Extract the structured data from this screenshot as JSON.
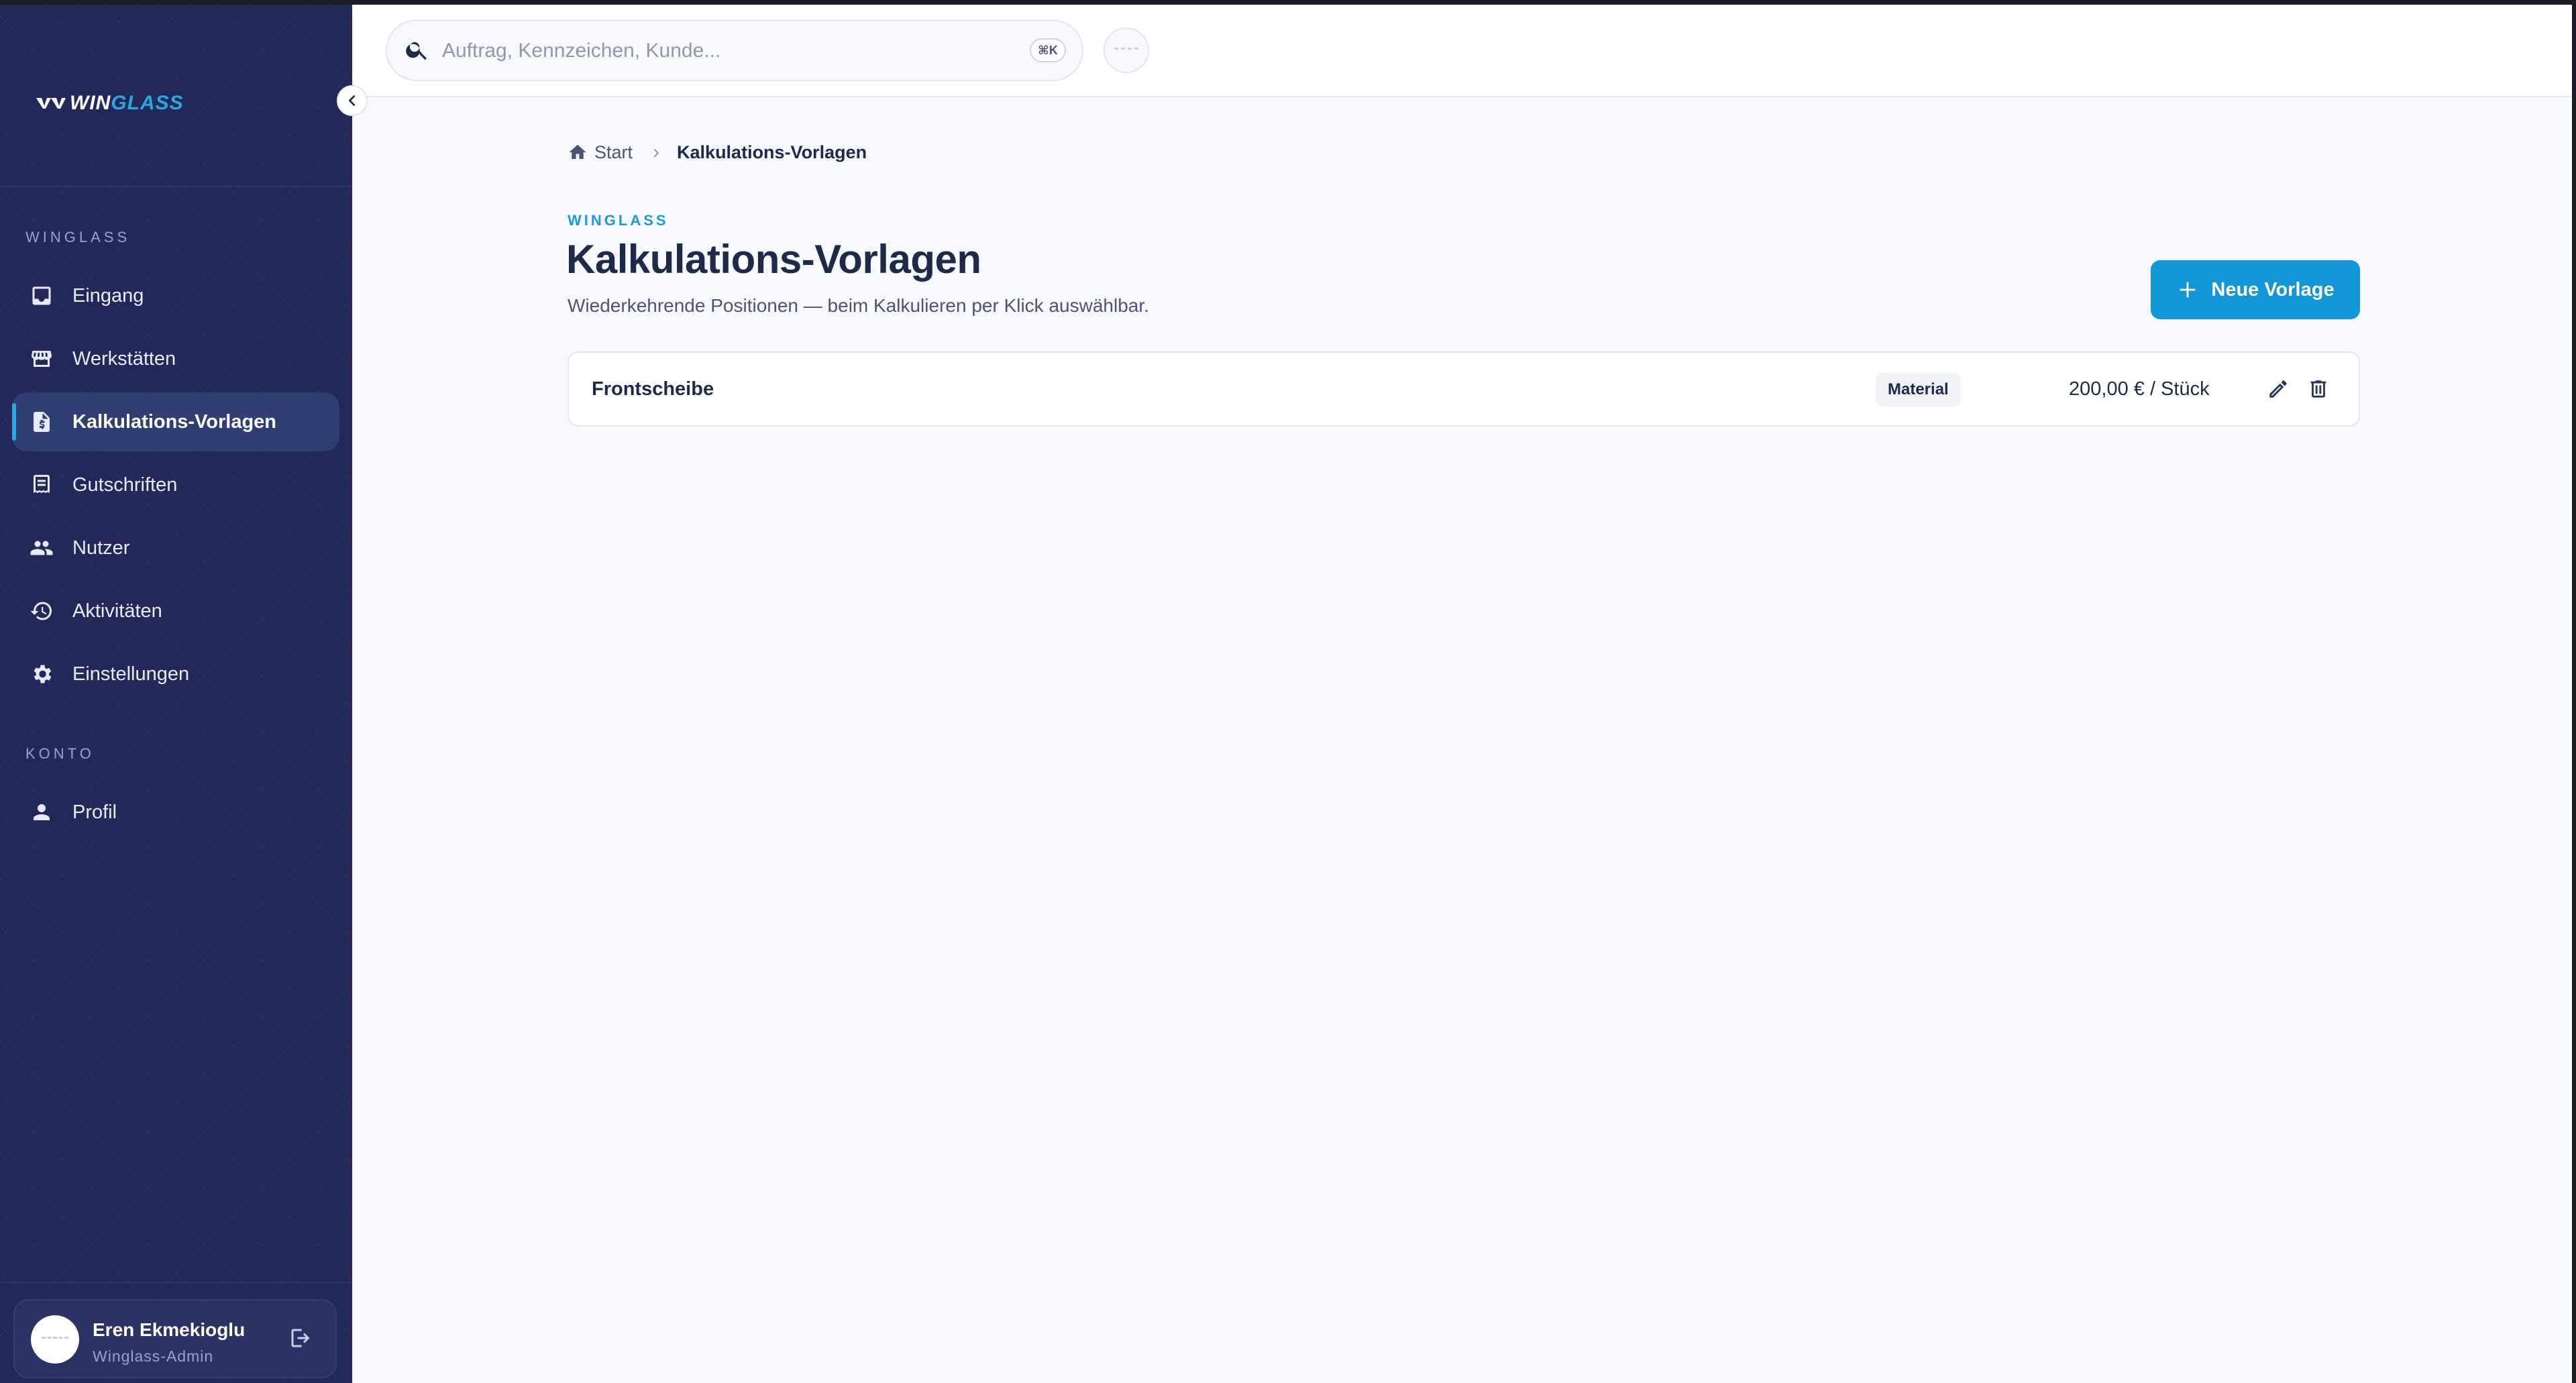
{
  "app": {
    "brand_part1": "WIN",
    "brand_part2": "GLASS"
  },
  "colors": {
    "sidebar_bg": "#22295a",
    "accent": "#1296d8",
    "page_bg": "#f6f8fb"
  },
  "sidebar": {
    "sections": [
      {
        "label": "WINGLASS",
        "items": [
          {
            "label": "Eingang",
            "icon": "inbox-icon",
            "active": false
          },
          {
            "label": "Werkstätten",
            "icon": "storefront-icon",
            "active": false
          },
          {
            "label": "Kalkulations-Vorlagen",
            "icon": "price-document-icon",
            "active": true
          },
          {
            "label": "Gutschriften",
            "icon": "receipt-icon",
            "active": false
          },
          {
            "label": "Nutzer",
            "icon": "users-icon",
            "active": false
          },
          {
            "label": "Aktivitäten",
            "icon": "history-icon",
            "active": false
          },
          {
            "label": "Einstellungen",
            "icon": "gear-icon",
            "active": false
          }
        ]
      },
      {
        "label": "KONTO",
        "items": [
          {
            "label": "Profil",
            "icon": "person-icon",
            "active": false
          }
        ]
      }
    ],
    "user": {
      "name": "Eren Ekmekioglu",
      "role": "Winglass-Admin"
    }
  },
  "topbar": {
    "search_placeholder": "Auftrag, Kennzeichen, Kunde...",
    "search_value": "",
    "shortcut": "⌘K"
  },
  "breadcrumb": {
    "home": "Start",
    "current": "Kalkulations-Vorlagen"
  },
  "page": {
    "eyebrow": "WINGLASS",
    "title": "Kalkulations-Vorlagen",
    "subtitle": "Wiederkehrende Positionen — beim Kalkulieren per Klick auswählbar.",
    "new_button": "Neue Vorlage"
  },
  "templates": [
    {
      "name": "Frontscheibe",
      "category": "Material",
      "price": "200,00 € / Stück"
    }
  ]
}
